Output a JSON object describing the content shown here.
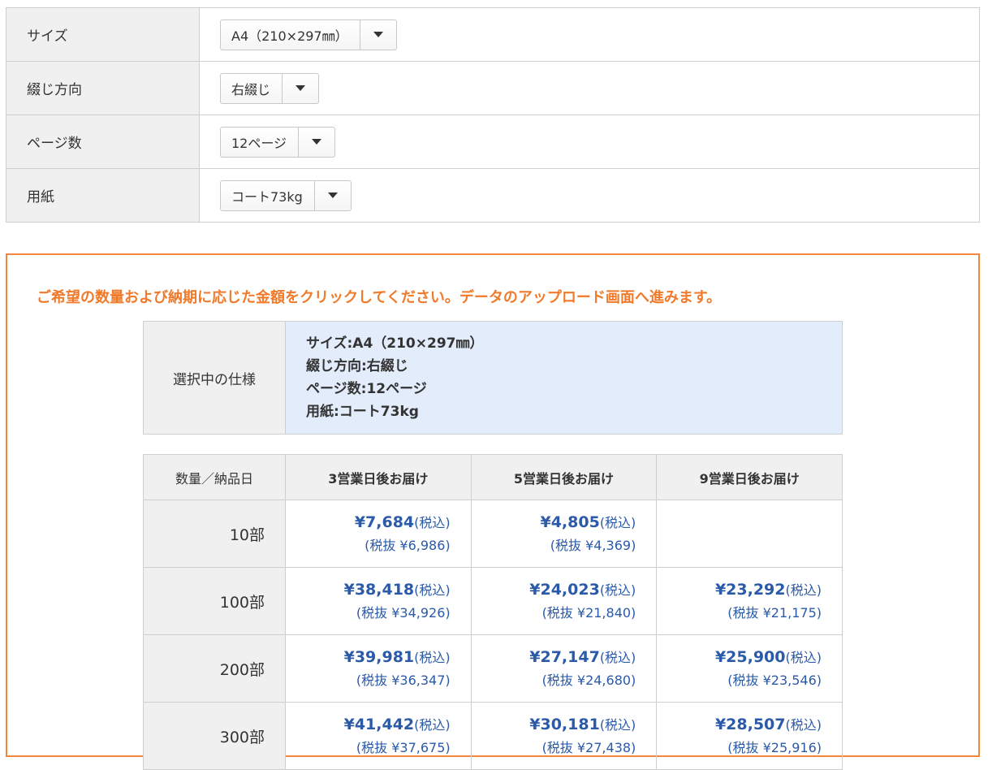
{
  "options": [
    {
      "label": "サイズ",
      "value": "A4（210×297㎜）"
    },
    {
      "label": "綴じ方向",
      "value": "右綴じ"
    },
    {
      "label": "ページ数",
      "value": "12ページ"
    },
    {
      "label": "用紙",
      "value": "コート73kg"
    }
  ],
  "instruction": "ご希望の数量および納期に応じた金額をクリックしてください。データのアップロード画面へ進みます。",
  "spec": {
    "label": "選択中の仕様",
    "lines": [
      "サイズ:A4（210×297㎜）",
      "綴じ方向:右綴じ",
      "ページ数:12ページ",
      "用紙:コート73kg"
    ]
  },
  "price_table": {
    "headers": [
      "数量／納品日",
      "3営業日後お届け",
      "5営業日後お届け",
      "9営業日後お届け"
    ],
    "tax_in_label": "(税込)",
    "rows": [
      {
        "qty": "10部",
        "prices": [
          {
            "incl": "¥7,684",
            "excl": "(税抜 ¥6,986)"
          },
          {
            "incl": "¥4,805",
            "excl": "(税抜 ¥4,369)"
          },
          {
            "incl": "",
            "excl": ""
          }
        ]
      },
      {
        "qty": "100部",
        "prices": [
          {
            "incl": "¥38,418",
            "excl": "(税抜 ¥34,926)"
          },
          {
            "incl": "¥24,023",
            "excl": "(税抜 ¥21,840)"
          },
          {
            "incl": "¥23,292",
            "excl": "(税抜 ¥21,175)"
          }
        ]
      },
      {
        "qty": "200部",
        "prices": [
          {
            "incl": "¥39,981",
            "excl": "(税抜 ¥36,347)"
          },
          {
            "incl": "¥27,147",
            "excl": "(税抜 ¥24,680)"
          },
          {
            "incl": "¥25,900",
            "excl": "(税抜 ¥23,546)"
          }
        ]
      },
      {
        "qty": "300部",
        "prices": [
          {
            "incl": "¥41,442",
            "excl": "(税抜 ¥37,675)"
          },
          {
            "incl": "¥30,181",
            "excl": "(税抜 ¥27,438)"
          },
          {
            "incl": "¥28,507",
            "excl": "(税抜 ¥25,916)"
          }
        ]
      }
    ]
  },
  "colors": {
    "accent_orange": "#f07a2a",
    "price_blue": "#2a5aa8",
    "spec_bg": "#e3ecfb"
  }
}
